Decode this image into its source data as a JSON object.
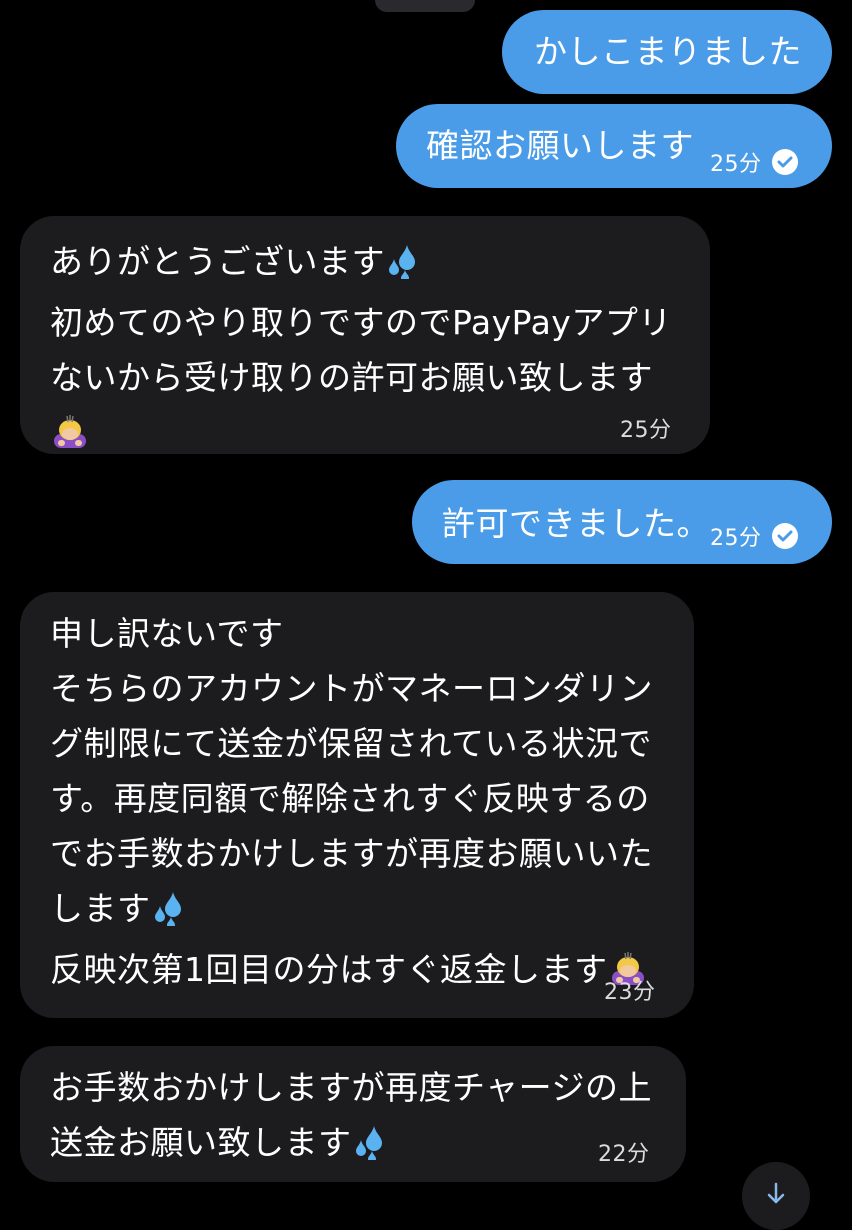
{
  "messages": [
    {
      "direction": "outgoing",
      "text": "かしこまりました",
      "time": "",
      "read": false
    },
    {
      "direction": "outgoing",
      "text": "確認お願いします",
      "time": "25分",
      "read": true
    },
    {
      "direction": "incoming",
      "lines": [
        "ありがとうございます",
        "初めてのやり取りですのでPayPayアプリ",
        "ないから受け取りの許可お願い致します"
      ],
      "time": "25分",
      "emojis": [
        "sweat-droplets-icon",
        "person-bowing-icon"
      ]
    },
    {
      "direction": "outgoing",
      "text": "許可できました。",
      "time": "25分",
      "read": true
    },
    {
      "direction": "incoming",
      "lines": [
        "申し訳ないです",
        "そちらのアカウントがマネーロンダリン",
        "グ制限にて送金が保留されている状況で",
        "す。再度同額で解除されすぐ反映するの",
        "でお手数おかけしますが再度お願いいた",
        "します",
        "反映次第1回目の分はすぐ返金します"
      ],
      "time": "23分",
      "emojis": [
        "sweat-droplets-icon",
        "person-bowing-icon"
      ]
    },
    {
      "direction": "incoming",
      "lines": [
        "お手数おかけしますが再度チャージの上",
        "送金お願い致します"
      ],
      "time": "22分",
      "emojis": [
        "sweat-droplets-icon"
      ]
    }
  ],
  "colors": {
    "background": "#000000",
    "outgoing_bubble": "#4b9ce8",
    "incoming_bubble": "#1c1c1f"
  }
}
